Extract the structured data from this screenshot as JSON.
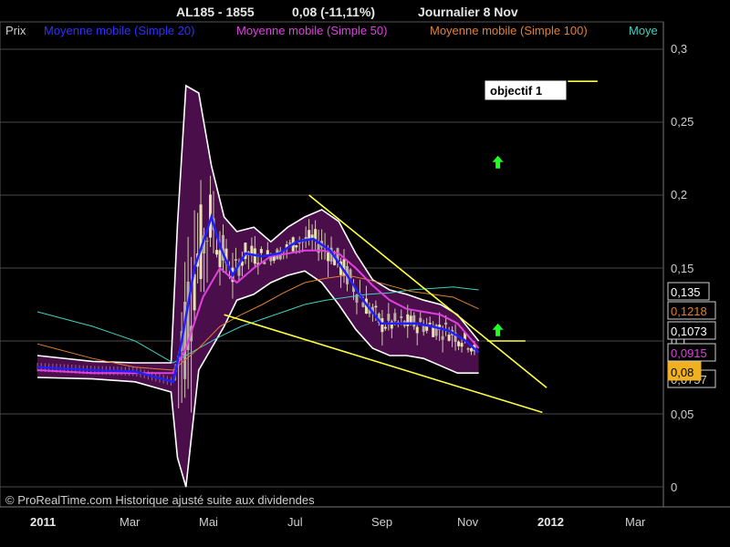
{
  "chart_data": {
    "type": "candlestick",
    "title": "AL185 - 1855",
    "title_change": "0,08 (-11,11%)",
    "title_period": "Journalier  8 Nov",
    "legend": [
      {
        "label": "Prix",
        "color": "#cfcfcf"
      },
      {
        "label": "Moyenne mobile (Simple 20)",
        "color": "#3030ff"
      },
      {
        "label": "Moyenne mobile (Simple 50)",
        "color": "#e040e0"
      },
      {
        "label": "Moyenne mobile (Simple 100)",
        "color": "#e08030"
      },
      {
        "label": "Moye",
        "color": "#40d0c0"
      }
    ],
    "y_axis": {
      "min": 0,
      "max": 0.3,
      "ticks": [
        "0",
        "0,05",
        "0,1",
        "0,15",
        "0,2",
        "0,25",
        "0,3"
      ],
      "tick_values": [
        0,
        0.05,
        0.1,
        0.15,
        0.2,
        0.25,
        0.3
      ],
      "position": "right",
      "grid": true
    },
    "x_axis": {
      "ticks": [
        {
          "label": "2011",
          "t": 0,
          "bold": true
        },
        {
          "label": "Mar",
          "t": 2
        },
        {
          "label": "Mai",
          "t": 4
        },
        {
          "label": "Jul",
          "t": 6
        },
        {
          "label": "Sep",
          "t": 8
        },
        {
          "label": "Nov",
          "t": 10
        },
        {
          "label": "2012",
          "t": 12,
          "bold": true
        },
        {
          "label": "Mar",
          "t": 14
        }
      ]
    },
    "value_boxes": [
      {
        "value": "0,135",
        "color": "#ffffff",
        "bg": "#000000"
      },
      {
        "value": "0,1218",
        "color": "#e08030",
        "bg": "#000000"
      },
      {
        "value": "0,1073",
        "color": "#ffffff",
        "bg": "#000000"
      },
      {
        "value": "0,0915",
        "color": "#e040e0",
        "bg": "#000000"
      },
      {
        "value": "0,08",
        "color": "#000000",
        "bg": "#f0b020"
      },
      {
        "value": "0,0757",
        "color": "#cfcfcf",
        "bg": "#000000"
      }
    ],
    "annotations": {
      "objectif_label": "objectif 1",
      "copyright": "© ProRealTime.com Historique ajusté suite aux dividendes"
    },
    "series_sma20": {
      "t": [
        -0.3,
        1.0,
        2.0,
        2.9,
        3.1,
        3.4,
        3.8,
        4.0,
        4.3,
        4.6,
        5.0,
        5.4,
        5.8,
        6.2,
        6.6,
        7.0,
        7.4,
        7.8,
        8.2,
        8.6,
        9.0,
        9.4,
        9.8,
        10.1
      ],
      "v": [
        0.082,
        0.08,
        0.079,
        0.072,
        0.1,
        0.15,
        0.185,
        0.165,
        0.145,
        0.16,
        0.158,
        0.16,
        0.168,
        0.17,
        0.162,
        0.145,
        0.127,
        0.112,
        0.112,
        0.112,
        0.11,
        0.107,
        0.1,
        0.092
      ]
    },
    "series_sma50": {
      "t": [
        -0.3,
        1.0,
        2.0,
        2.9,
        3.2,
        3.6,
        4.0,
        4.4,
        4.8,
        5.2,
        5.6,
        6.0,
        6.4,
        6.8,
        7.2,
        7.6,
        8.0,
        8.4,
        8.8,
        9.2,
        9.6,
        10.1
      ],
      "v": [
        0.08,
        0.078,
        0.078,
        0.078,
        0.095,
        0.13,
        0.15,
        0.14,
        0.15,
        0.158,
        0.16,
        0.162,
        0.162,
        0.16,
        0.15,
        0.138,
        0.128,
        0.122,
        0.12,
        0.118,
        0.112,
        0.095
      ]
    },
    "series_sma100": {
      "t": [
        -0.3,
        1.0,
        2.0,
        2.9,
        3.5,
        4.0,
        4.5,
        5.0,
        5.5,
        6.0,
        6.5,
        7.0,
        7.5,
        8.0,
        8.5,
        9.0,
        9.5,
        10.1
      ],
      "v": [
        0.098,
        0.088,
        0.082,
        0.08,
        0.095,
        0.11,
        0.118,
        0.125,
        0.133,
        0.14,
        0.143,
        0.145,
        0.142,
        0.138,
        0.134,
        0.132,
        0.13,
        0.122
      ]
    },
    "series_sma200": {
      "t": [
        -0.3,
        1.0,
        2.0,
        2.9,
        3.5,
        4.0,
        4.5,
        5.0,
        5.5,
        6.0,
        6.5,
        7.0,
        7.5,
        8.0,
        8.5,
        9.0,
        9.5,
        10.1
      ],
      "v": [
        0.12,
        0.11,
        0.1,
        0.085,
        0.095,
        0.103,
        0.11,
        0.115,
        0.12,
        0.125,
        0.128,
        0.13,
        0.132,
        0.133,
        0.135,
        0.136,
        0.137,
        0.135
      ]
    },
    "bollinger_upper": {
      "t": [
        -0.3,
        1.0,
        2.0,
        2.85,
        3.0,
        3.2,
        3.5,
        3.8,
        4.1,
        4.4,
        4.8,
        5.2,
        5.6,
        6.0,
        6.4,
        6.8,
        7.2,
        7.6,
        8.0,
        8.4,
        8.8,
        9.2,
        9.6,
        10.1
      ],
      "v": [
        0.09,
        0.086,
        0.085,
        0.085,
        0.18,
        0.275,
        0.27,
        0.22,
        0.185,
        0.175,
        0.178,
        0.168,
        0.178,
        0.185,
        0.19,
        0.182,
        0.16,
        0.142,
        0.135,
        0.132,
        0.128,
        0.125,
        0.118,
        0.1
      ]
    },
    "bollinger_lower": {
      "t": [
        -0.3,
        1.0,
        2.0,
        2.85,
        3.0,
        3.2,
        3.5,
        3.8,
        4.1,
        4.4,
        4.8,
        5.2,
        5.6,
        6.0,
        6.4,
        6.8,
        7.2,
        7.6,
        8.0,
        8.4,
        8.8,
        9.2,
        9.6,
        10.1
      ],
      "v": [
        0.075,
        0.074,
        0.072,
        0.065,
        0.02,
        0.0,
        0.08,
        0.095,
        0.11,
        0.128,
        0.132,
        0.14,
        0.145,
        0.148,
        0.14,
        0.125,
        0.108,
        0.095,
        0.09,
        0.09,
        0.088,
        0.083,
        0.078,
        0.078
      ]
    },
    "trend_lines": [
      {
        "t1": 6.1,
        "v1": 0.2,
        "t2": 11.7,
        "v2": 0.068,
        "color": "#ffff40"
      },
      {
        "t1": 4.1,
        "v1": 0.118,
        "t2": 11.6,
        "v2": 0.051,
        "color": "#ffff40"
      }
    ],
    "target_lines": [
      {
        "t1": 12.2,
        "t2": 12.9,
        "v": 0.278,
        "color": "#ffff40"
      },
      {
        "t1": 10.3,
        "t2": 11.2,
        "v": 0.1,
        "color": "#ffff40"
      }
    ],
    "arrows": [
      {
        "t": 10.55,
        "v": 0.222,
        "color": "#20ff20"
      },
      {
        "t": 10.55,
        "v": 0.107,
        "color": "#20ff20"
      }
    ]
  }
}
